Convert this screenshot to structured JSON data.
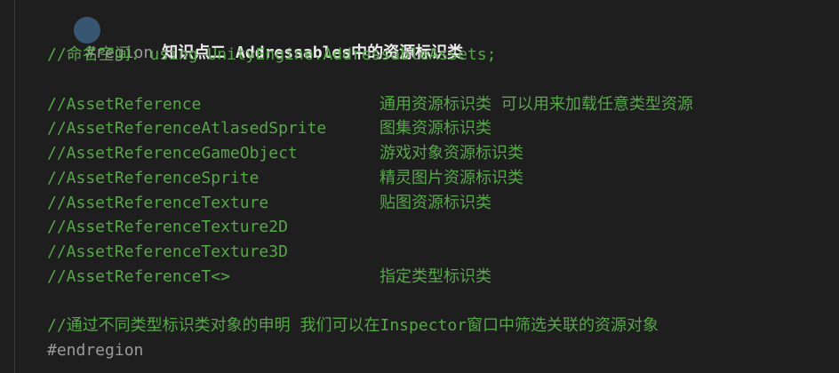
{
  "region": {
    "keyword": "#region",
    "title": "知识点二 Addressables中的资源标识类",
    "end": "#endregion"
  },
  "namespace_comment": "//命名空间: using UnityEngine.AddressableAssets;",
  "references": [
    {
      "name": "//AssetReference",
      "desc": "通用资源标识类 可以用来加载任意类型资源"
    },
    {
      "name": "//AssetReferenceAtlasedSprite",
      "desc": "图集资源标识类"
    },
    {
      "name": "//AssetReferenceGameObject",
      "desc": "游戏对象资源标识类"
    },
    {
      "name": "//AssetReferenceSprite",
      "desc": "精灵图片资源标识类"
    },
    {
      "name": "//AssetReferenceTexture",
      "desc": "贴图资源标识类"
    },
    {
      "name": "//AssetReferenceTexture2D",
      "desc": ""
    },
    {
      "name": "//AssetReferenceTexture3D",
      "desc": ""
    },
    {
      "name": "//AssetReferenceT<>",
      "desc": "指定类型标识类"
    }
  ],
  "summary_comment": "//通过不同类型标识类对象的申明 我们可以在Inspector窗口中筛选关联的资源对象",
  "colors": {
    "background": "#1e1e1e",
    "comment": "#57a64a",
    "directive": "#9b9b9b"
  }
}
